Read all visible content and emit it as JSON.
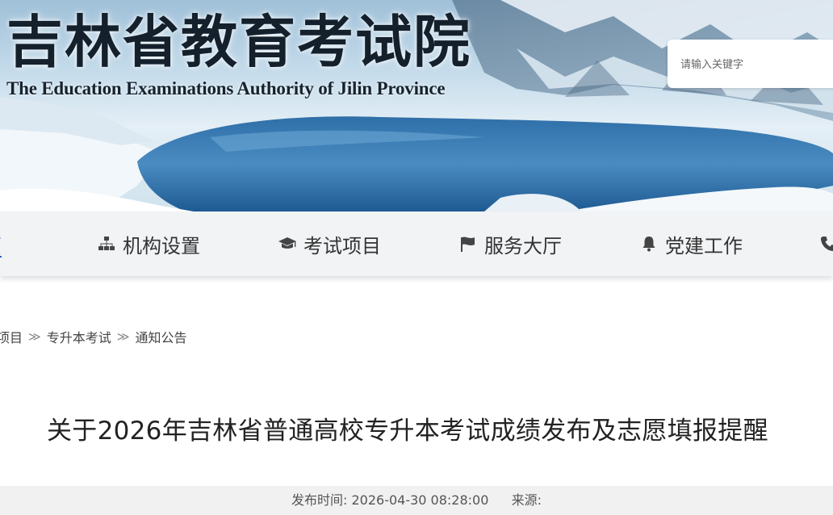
{
  "header": {
    "title": "吉林省教育考试院",
    "subtitle": "The Education Examinations Authority of Jilin Province"
  },
  "search": {
    "placeholder": "请输入关键字"
  },
  "nav": {
    "items": [
      {
        "label": "页",
        "icon": "home"
      },
      {
        "label": "机构设置",
        "icon": "sitemap-icon"
      },
      {
        "label": "考试项目",
        "icon": "graduation-cap-icon"
      },
      {
        "label": "服务大厅",
        "icon": "flag-icon"
      },
      {
        "label": "党建工作",
        "icon": "bell-icon"
      }
    ],
    "active_color": "#1f5fbf"
  },
  "breadcrumb": {
    "items": [
      "项目",
      "专升本考试",
      "通知公告"
    ],
    "separator": "≫"
  },
  "article": {
    "title": "关于2026年吉林省普通高校专升本考试成绩发布及志愿填报提醒",
    "publish_label": "发布时间:",
    "publish_time": "2026-04-30 08:28:00",
    "source_label": "来源:",
    "source": ""
  }
}
